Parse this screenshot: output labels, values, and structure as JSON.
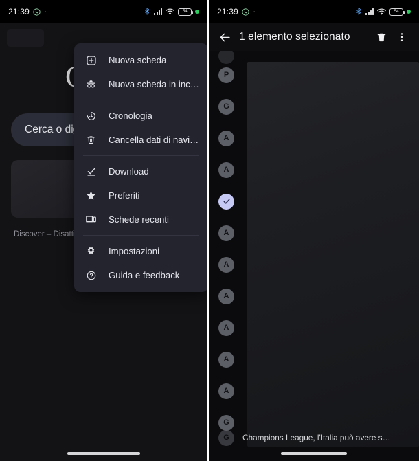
{
  "left_phone": {
    "status_bar": {
      "time": "21:39",
      "icons_left": [
        "whatsapp-icon",
        "dot-icon"
      ],
      "icons_right": [
        "bluetooth-icon",
        "signal-icon",
        "wifi-icon",
        "battery-icon",
        "green-dot-icon"
      ],
      "battery_level": "54"
    },
    "ntp": {
      "logo": "G",
      "search_placeholder": "Cerca o digita un URL",
      "search_value": "Cerca o digita",
      "discover_label": "Discover – Disattiva"
    },
    "menu": {
      "items": [
        {
          "label": "Nuova scheda",
          "icon": "new-tab-icon"
        },
        {
          "label": "Nuova scheda in incogn…",
          "icon": "incognito-icon"
        },
        {
          "label": "Cronologia",
          "icon": "history-icon",
          "divider_before": true
        },
        {
          "label": "Cancella dati di navigazi…",
          "icon": "trash-icon"
        },
        {
          "label": "Download",
          "icon": "download-icon",
          "divider_before": true
        },
        {
          "label": "Preferiti",
          "icon": "star-icon"
        },
        {
          "label": "Schede recenti",
          "icon": "recent-tabs-icon"
        },
        {
          "label": "Impostazioni",
          "icon": "gear-icon",
          "divider_before": true
        },
        {
          "label": "Guida e feedback",
          "icon": "help-icon"
        }
      ]
    }
  },
  "right_phone": {
    "status_bar": {
      "time": "21:39",
      "icons_left": [
        "whatsapp-icon",
        "dot-icon"
      ],
      "icons_right": [
        "bluetooth-icon",
        "signal-icon",
        "wifi-icon",
        "battery-icon",
        "green-dot-icon"
      ],
      "battery_level": "54"
    },
    "app_bar": {
      "back_icon": "arrow-back-icon",
      "title": "1 elemento selezionato",
      "delete_icon": "trash-icon",
      "overflow_icon": "more-vert-icon"
    },
    "list": {
      "rows": [
        {
          "avatar": "P",
          "selected": false
        },
        {
          "avatar": "G",
          "selected": false
        },
        {
          "avatar": "A",
          "selected": false
        },
        {
          "avatar": "A",
          "selected": false
        },
        {
          "avatar": "✓",
          "selected": true
        },
        {
          "avatar": "A",
          "selected": false
        },
        {
          "avatar": "A",
          "selected": false
        },
        {
          "avatar": "A",
          "selected": false
        },
        {
          "avatar": "A",
          "selected": false
        },
        {
          "avatar": "A",
          "selected": false
        },
        {
          "avatar": "A",
          "selected": false
        },
        {
          "avatar": "G",
          "selected": false
        },
        {
          "avatar": "G",
          "selected": false
        }
      ],
      "last_item_title": "Champions League, l'Italia può avere s…"
    }
  },
  "colors": {
    "menu_bg": "#23242e",
    "ntp_bg": "#131316",
    "list_bg": "#0b0b0d",
    "selected_avatar": "#c7c9f5",
    "accent_green": "#2ecc5e"
  }
}
